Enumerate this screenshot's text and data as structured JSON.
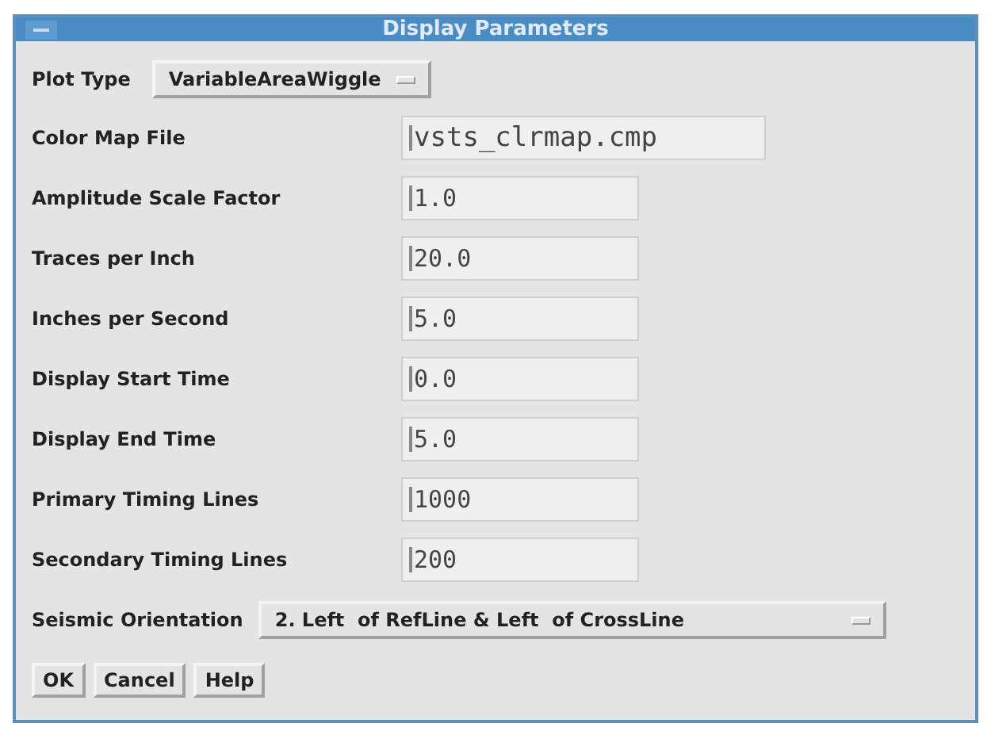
{
  "window": {
    "title": "Display Parameters"
  },
  "plot_type": {
    "label": "Plot Type",
    "value": "VariableAreaWiggle"
  },
  "fields": [
    {
      "label": "Color Map File",
      "value": "vsts_clrmap.cmp",
      "kind": "file"
    },
    {
      "label": "Amplitude Scale Factor",
      "value": "1.0",
      "kind": "number"
    },
    {
      "label": "Traces per Inch",
      "value": "20.0",
      "kind": "number"
    },
    {
      "label": "Inches per Second",
      "value": "5.0",
      "kind": "number"
    },
    {
      "label": "Display Start Time",
      "value": "0.0",
      "kind": "number"
    },
    {
      "label": "Display End Time",
      "value": "5.0",
      "kind": "number"
    },
    {
      "label": "Primary Timing Lines",
      "value": "1000",
      "kind": "number"
    },
    {
      "label": "Secondary Timing Lines",
      "value": "200",
      "kind": "number"
    }
  ],
  "orientation": {
    "label": "Seismic Orientation",
    "value": "2. Left  of RefLine & Left  of CrossLine"
  },
  "buttons": [
    "OK",
    "Cancel",
    "Help"
  ]
}
